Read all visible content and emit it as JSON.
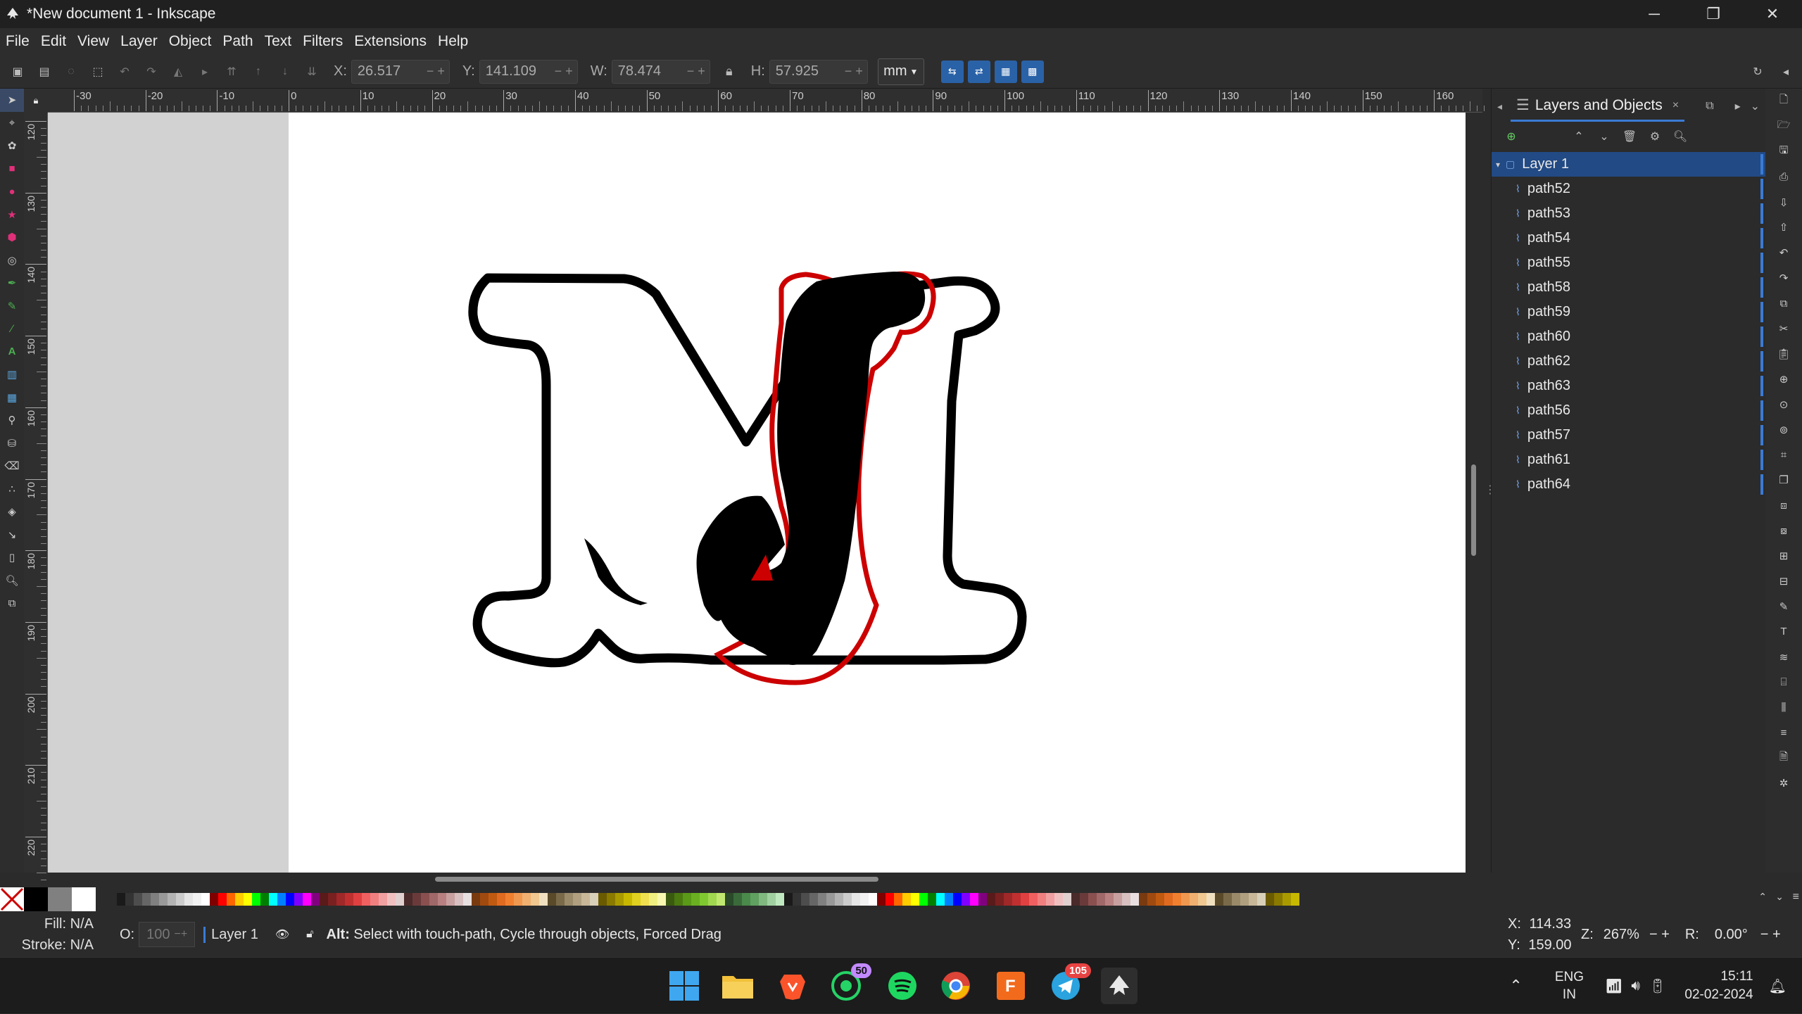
{
  "window": {
    "title": "*New document 1 - Inkscape",
    "minimize": "─",
    "maximize": "❐",
    "close": "✕"
  },
  "menu": [
    "File",
    "Edit",
    "View",
    "Layer",
    "Object",
    "Path",
    "Text",
    "Filters",
    "Extensions",
    "Help"
  ],
  "toolctrl": {
    "x_label": "X:",
    "x": "26.517",
    "y_label": "Y:",
    "y": "141.109",
    "w_label": "W:",
    "w": "78.474",
    "h_label": "H:",
    "h": "57.925",
    "unit": "mm"
  },
  "rulers": {
    "h_ticks": [
      "-30",
      "-20",
      "-10",
      "0",
      "10",
      "20",
      "30",
      "40",
      "50",
      "60",
      "70",
      "80",
      "90",
      "100",
      "110",
      "120",
      "130",
      "140",
      "150",
      "160"
    ],
    "v_ticks": [
      "120",
      "130",
      "140",
      "150",
      "160",
      "170",
      "180",
      "190",
      "200",
      "210",
      "220"
    ]
  },
  "panel": {
    "tab_label": "Layers and Objects",
    "tab_close": "×",
    "layer": "Layer 1",
    "objects": [
      "path52",
      "path53",
      "path54",
      "path55",
      "path58",
      "path59",
      "path60",
      "path62",
      "path63",
      "path56",
      "path57",
      "path61",
      "path64"
    ]
  },
  "colors": {
    "accent": "#3a7bd5",
    "selection": "#224a84",
    "red_outline": "#cc0000"
  },
  "status": {
    "fill_label": "Fill:",
    "fill_value": "N/A",
    "stroke_label": "Stroke:",
    "stroke_value": "N/A",
    "opacity_label": "O:",
    "opacity_value": "100",
    "layer": "Layer 1",
    "message_bold": "Alt:",
    "message": " Select with touch-path, Cycle through objects, Forced Drag",
    "cursor_x_label": "X:",
    "cursor_x": "114.33",
    "cursor_y_label": "Y:",
    "cursor_y": "159.00",
    "zoom_label": "Z:",
    "zoom": "267%",
    "rotation_label": "R:",
    "rotation": "0.00°"
  },
  "taskbar": {
    "whatsapp_badge": "50",
    "telegram_badge": "105",
    "lang_top": "ENG",
    "lang_bottom": "IN",
    "time": "15:11",
    "date": "02-02-2024"
  },
  "icons": [
    "inkscape-logo-icon",
    "selector-tool-icon",
    "node-tool-icon",
    "rectangle-tool-icon",
    "ellipse-tool-icon",
    "text-tool-icon",
    "zoom-tool-icon",
    "lock-icon",
    "eye-icon",
    "search-icon",
    "settings-icon",
    "delete-icon",
    "windows-start-icon",
    "file-explorer-icon",
    "brave-icon",
    "whatsapp-icon",
    "spotify-icon",
    "chrome-icon",
    "fusion360-icon",
    "telegram-icon",
    "wifi-icon",
    "volume-icon",
    "battery-icon"
  ]
}
